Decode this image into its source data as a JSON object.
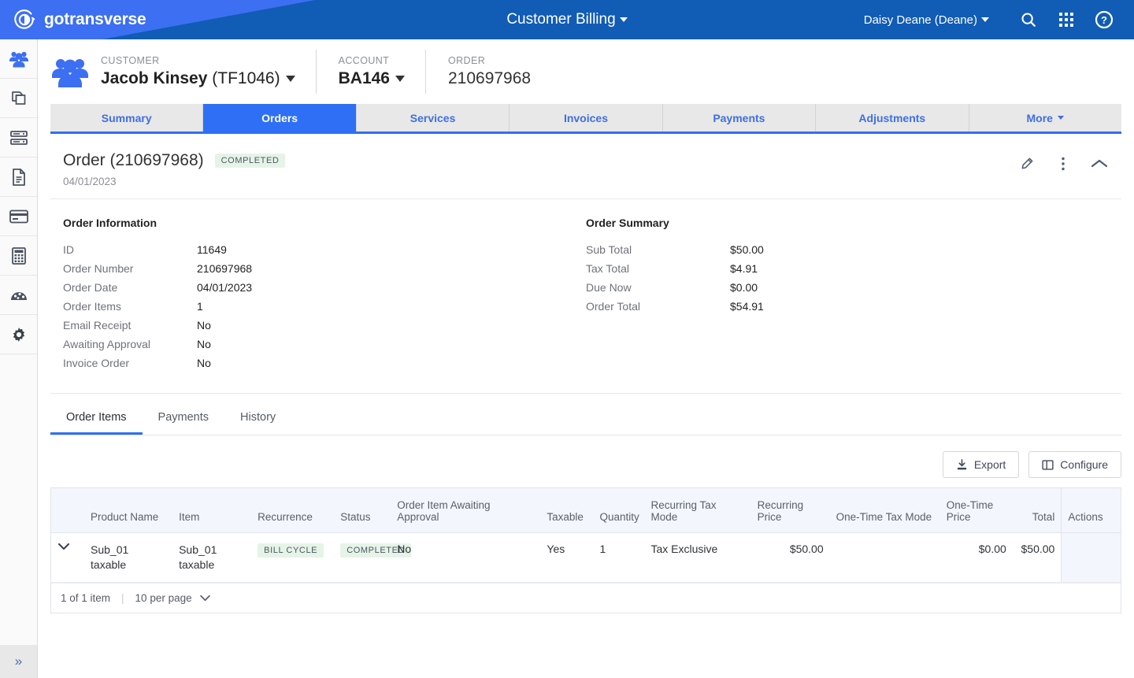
{
  "topbar": {
    "brand": "gotransverse",
    "app_title": "Customer Billing",
    "user": "Daisy Deane (Deane)",
    "icons": [
      "search-icon",
      "apps-grid-icon",
      "help-icon"
    ],
    "bg_dark": "#115cb4",
    "bg_light": "#3d6ff2"
  },
  "rail": {
    "items": [
      {
        "name": "customers-icon",
        "active": true
      },
      {
        "name": "products-icon",
        "active": false
      },
      {
        "name": "servers-icon",
        "active": false
      },
      {
        "name": "documents-icon",
        "active": false
      },
      {
        "name": "billing-card-icon",
        "active": false
      },
      {
        "name": "calculator-icon",
        "active": false
      },
      {
        "name": "dashboard-icon",
        "active": false
      },
      {
        "name": "settings-gear-icon",
        "active": false
      }
    ],
    "expand_glyph": "»"
  },
  "context": {
    "customer_label": "CUSTOMER",
    "customer_name": "Jacob Kinsey",
    "customer_code": "(TF1046)",
    "account_label": "ACCOUNT",
    "account_value": "BA146",
    "order_label": "ORDER",
    "order_value": "210697968"
  },
  "tabs": [
    {
      "label": "Summary",
      "active": false,
      "caret": false
    },
    {
      "label": "Orders",
      "active": true,
      "caret": false
    },
    {
      "label": "Services",
      "active": false,
      "caret": false
    },
    {
      "label": "Invoices",
      "active": false,
      "caret": false
    },
    {
      "label": "Payments",
      "active": false,
      "caret": false
    },
    {
      "label": "Adjustments",
      "active": false,
      "caret": false
    },
    {
      "label": "More",
      "active": false,
      "caret": true
    }
  ],
  "order": {
    "title": "Order (210697968)",
    "status_badge": "COMPLETED",
    "date": "04/01/2023",
    "actions": [
      "edit-pencil-icon",
      "more-vertical-icon",
      "collapse-chevron-icon"
    ]
  },
  "order_information": {
    "title": "Order Information",
    "rows": [
      {
        "key": "ID",
        "value": "11649"
      },
      {
        "key": "Order Number",
        "value": "210697968"
      },
      {
        "key": "Order Date",
        "value": "04/01/2023"
      },
      {
        "key": "Order Items",
        "value": "1"
      },
      {
        "key": "Email Receipt",
        "value": "No"
      },
      {
        "key": "Awaiting Approval",
        "value": "No"
      },
      {
        "key": "Invoice Order",
        "value": "No"
      }
    ]
  },
  "order_summary": {
    "title": "Order Summary",
    "rows": [
      {
        "key": "Sub Total",
        "value": "$50.00"
      },
      {
        "key": "Tax Total",
        "value": "$4.91"
      },
      {
        "key": "Due Now",
        "value": "$0.00"
      },
      {
        "key": "Order Total",
        "value": "$54.91"
      }
    ]
  },
  "subtabs": [
    {
      "label": "Order Items",
      "active": true
    },
    {
      "label": "Payments",
      "active": false
    },
    {
      "label": "History",
      "active": false
    }
  ],
  "toolbar": {
    "export_label": "Export",
    "configure_label": "Configure"
  },
  "table": {
    "columns": [
      {
        "label": "",
        "align": "left"
      },
      {
        "label": "Product Name",
        "align": "left"
      },
      {
        "label": "Item",
        "align": "left"
      },
      {
        "label": "Recurrence",
        "align": "left"
      },
      {
        "label": "Status",
        "align": "left"
      },
      {
        "label": "Order Item Awaiting Approval",
        "align": "left"
      },
      {
        "label": "Taxable",
        "align": "left"
      },
      {
        "label": "Quantity",
        "align": "left"
      },
      {
        "label": "Recurring Tax Mode",
        "align": "left"
      },
      {
        "label": "Recurring Price",
        "align": "right"
      },
      {
        "label": "One-Time Tax Mode",
        "align": "left"
      },
      {
        "label": "One-Time Price",
        "align": "right"
      },
      {
        "label": "Total",
        "align": "right"
      },
      {
        "label": "Actions",
        "align": "left"
      }
    ],
    "rows": [
      {
        "product_name": "Sub_01 taxable",
        "item": "Sub_01 taxable",
        "recurrence": "BILL CYCLE",
        "status": "COMPLETED",
        "awaiting_approval": "No",
        "taxable": "Yes",
        "quantity": "1",
        "recurring_tax_mode": "Tax Exclusive",
        "recurring_price": "$50.00",
        "one_time_tax_mode": "",
        "one_time_price": "$0.00",
        "total": "$50.00",
        "actions": ""
      }
    ],
    "pager": {
      "count_text": "1 of 1 item",
      "divider": "|",
      "per_page": "10 per page"
    }
  },
  "colors": {
    "accent": "#2f6ff5",
    "badge_green_bg": "#e6f4e8",
    "table_header_bg": "#f3f7fd"
  }
}
